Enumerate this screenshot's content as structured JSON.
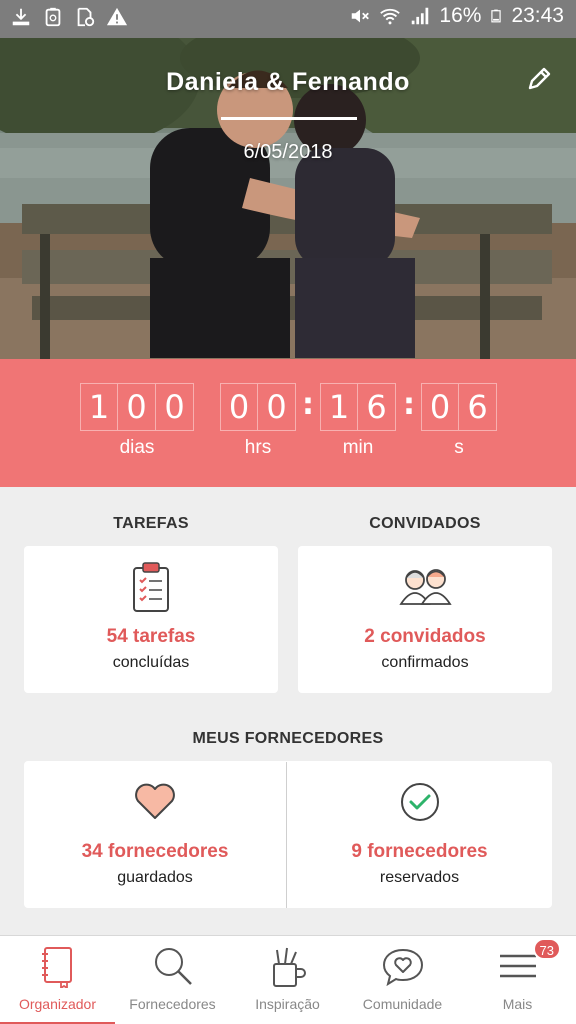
{
  "status_bar": {
    "battery": "16%",
    "time": "23:43",
    "icons_left": [
      "download-icon",
      "recycle-icon",
      "file-clock-icon",
      "warning-icon"
    ],
    "icons_right": [
      "mute-icon",
      "wifi-icon",
      "signal-icon",
      "battery-icon"
    ]
  },
  "hero": {
    "title": "Daniela & Fernando",
    "date": "6/05/2018",
    "edit_icon": "pencil-icon"
  },
  "countdown": {
    "days": [
      "1",
      "0",
      "0"
    ],
    "hours": [
      "0",
      "0"
    ],
    "minutes": [
      "1",
      "6"
    ],
    "seconds": [
      "0",
      "6"
    ],
    "labels": {
      "days": "dias",
      "hours": "hrs",
      "minutes": "min",
      "seconds": "s"
    }
  },
  "tarefas": {
    "header": "TAREFAS",
    "main": "54 tarefas",
    "sub": "concluídas",
    "icon": "clipboard-checklist-icon"
  },
  "convidados": {
    "header": "CONVIDADOS",
    "main": "2 convidados",
    "sub": "confirmados",
    "icon": "guests-icon"
  },
  "fornecedores": {
    "header": "MEUS FORNECEDORES",
    "saved": {
      "main": "34 fornecedores",
      "sub": "guardados",
      "icon": "heart-icon"
    },
    "reserved": {
      "main": "9 fornecedores",
      "sub": "reservados",
      "icon": "check-circle-icon"
    }
  },
  "bottom_nav": {
    "items": [
      {
        "label": "Organizador",
        "icon": "notebook-icon",
        "active": true
      },
      {
        "label": "Fornecedores",
        "icon": "search-icon",
        "active": false
      },
      {
        "label": "Inspiração",
        "icon": "pencil-cup-icon",
        "active": false
      },
      {
        "label": "Comunidade",
        "icon": "chat-heart-icon",
        "active": false
      },
      {
        "label": "Mais",
        "icon": "menu-icon",
        "active": false,
        "badge": "73"
      }
    ]
  },
  "colors": {
    "accent": "#f07575",
    "accent_text": "#e05a5a",
    "status_bar": "#7d7d7d"
  }
}
